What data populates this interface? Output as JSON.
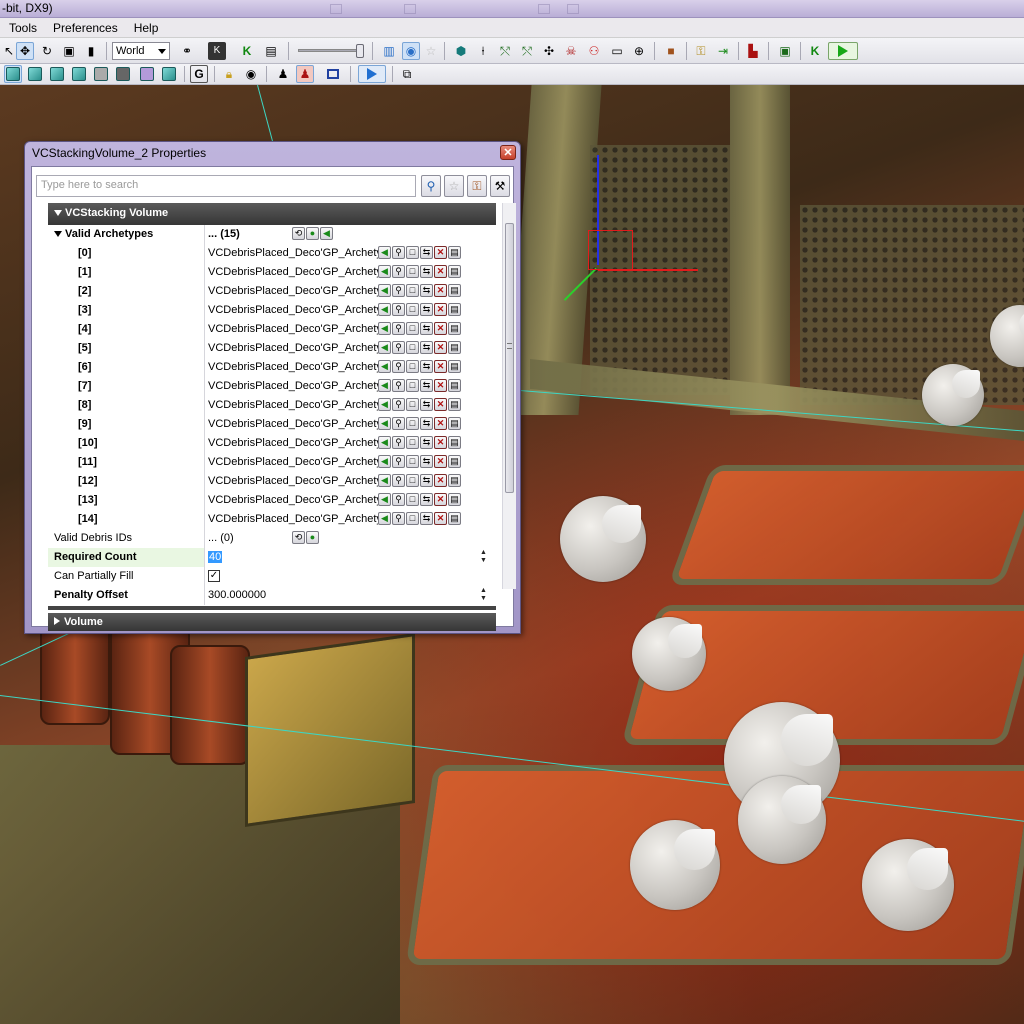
{
  "window": {
    "title": "-bit, DX9)"
  },
  "menu": [
    "Tools",
    "Preferences",
    "Help"
  ],
  "toolbar": {
    "coordinate_system": "World",
    "grid_icon_label": "G"
  },
  "properties_window": {
    "title": "VCStackingVolume_2 Properties",
    "search_placeholder": "Type here to search",
    "section_title": "VCStacking Volume",
    "collapsed_section_title": "Volume",
    "valid_archetypes": {
      "label": "Valid Archetypes",
      "value": "... (15)",
      "items": [
        {
          "index": "[0]",
          "value": "VCDebrisPlaced_Deco'GP_Archetypes.Obje"
        },
        {
          "index": "[1]",
          "value": "VCDebrisPlaced_Deco'GP_Archetypes.Obje"
        },
        {
          "index": "[2]",
          "value": "VCDebrisPlaced_Deco'GP_Archetypes.Obje"
        },
        {
          "index": "[3]",
          "value": "VCDebrisPlaced_Deco'GP_Archetypes.Obje"
        },
        {
          "index": "[4]",
          "value": "VCDebrisPlaced_Deco'GP_Archetypes.Obje"
        },
        {
          "index": "[5]",
          "value": "VCDebrisPlaced_Deco'GP_Archetypes.Obje"
        },
        {
          "index": "[6]",
          "value": "VCDebrisPlaced_Deco'GP_Archetypes.Obje"
        },
        {
          "index": "[7]",
          "value": "VCDebrisPlaced_Deco'GP_Archetypes.Obje"
        },
        {
          "index": "[8]",
          "value": "VCDebrisPlaced_Deco'GP_Archetypes.Obje"
        },
        {
          "index": "[9]",
          "value": "VCDebrisPlaced_Deco'GP_Archetypes.Obje"
        },
        {
          "index": "[10]",
          "value": "VCDebrisPlaced_Deco'GP_Archetypes.Obje"
        },
        {
          "index": "[11]",
          "value": "VCDebrisPlaced_Deco'GP_Archetypes.Obje"
        },
        {
          "index": "[12]",
          "value": "VCDebrisPlaced_Deco'GP_Archetypes.Obje"
        },
        {
          "index": "[13]",
          "value": "VCDebrisPlaced_Deco'GP_Archetypes.Obje"
        },
        {
          "index": "[14]",
          "value": "VCDebrisPlaced_Deco'GP_Archetypes.Obje"
        }
      ]
    },
    "valid_debris_ids": {
      "label": "Valid Debris IDs",
      "value": "... (0)"
    },
    "required_count": {
      "label": "Required Count",
      "value": "40"
    },
    "can_partially_fill": {
      "label": "Can Partially Fill",
      "checked": true,
      "check_glyph": "✓"
    },
    "penalty_offset": {
      "label": "Penalty Offset",
      "value": "300.000000"
    }
  },
  "colors": {
    "section_header": "#444444",
    "selection": "#3399ff",
    "gizmo_x": "#e21b1b",
    "gizmo_y": "#2530e8",
    "gizmo_z": "#2ccf2c"
  }
}
